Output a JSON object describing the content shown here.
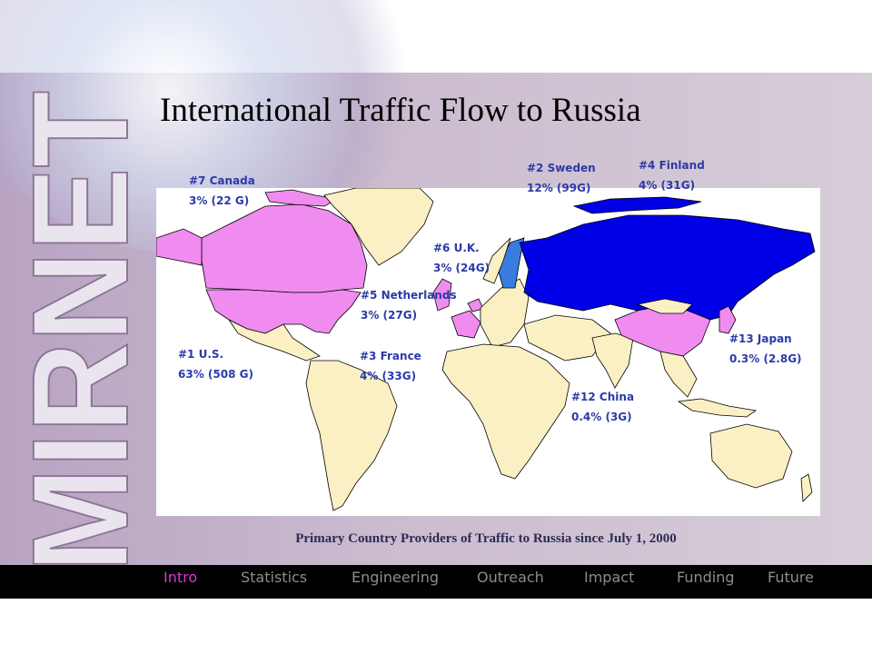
{
  "slide": {
    "title": "International Traffic Flow to Russia",
    "logo_text": "MIRNET",
    "caption": "Primary Country Providers of Traffic to Russia since July 1, 2000"
  },
  "countries": [
    {
      "rank": "#1 U.S.",
      "value": "63% (508 G)"
    },
    {
      "rank": "#2  Sweden",
      "value": "12% (99G)"
    },
    {
      "rank": "#3 France",
      "value": "4% (33G)"
    },
    {
      "rank": "#4 Finland",
      "value": "4% (31G)"
    },
    {
      "rank": "#5 Netherlands",
      "value": "3% (27G)"
    },
    {
      "rank": "#6 U.K.",
      "value": "3% (24G)"
    },
    {
      "rank": "#7 Canada",
      "value": "3% (22 G)"
    },
    {
      "rank": "#12 China",
      "value": "0.4% (3G)"
    },
    {
      "rank": "#13 Japan",
      "value": "0.3% (2.8G)"
    }
  ],
  "nav": {
    "items": [
      "Intro",
      "Statistics",
      "Engineering",
      "Outreach",
      "Impact",
      "Funding",
      "Future"
    ],
    "active": "Intro"
  },
  "colors": {
    "russia": "#0000e6",
    "provider": "#f08cf0",
    "other": "#fbf0c4",
    "sweden_finland": "#3a7be0",
    "label": "#2b3aa8",
    "nav_active": "#d43ccf",
    "nav_inactive": "#8c8c8c"
  }
}
